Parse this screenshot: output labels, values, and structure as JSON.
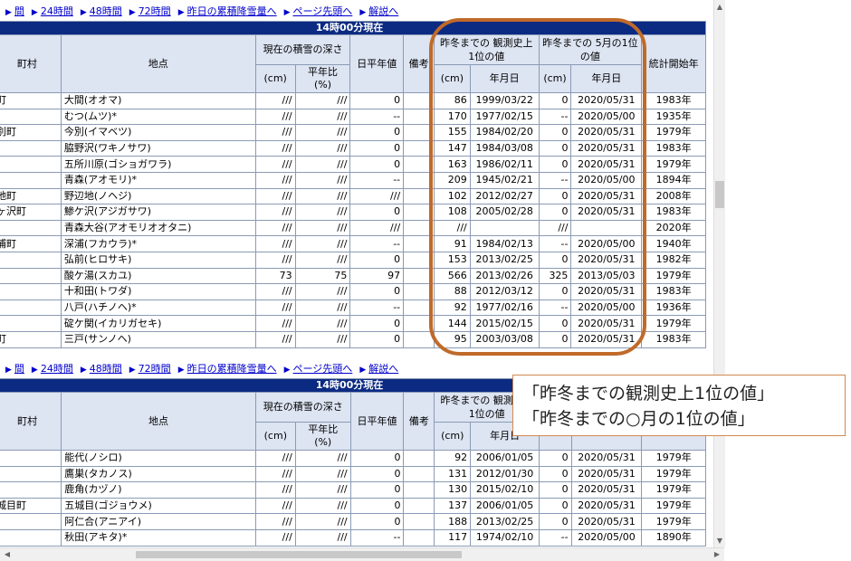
{
  "nav_links": [
    {
      "sep": "▶",
      "label": "間"
    },
    {
      "sep": "▶",
      "label": "24時間"
    },
    {
      "sep": "▶",
      "label": "48時間"
    },
    {
      "sep": "▶",
      "label": "72時間"
    },
    {
      "sep": "▶",
      "label": "昨日の累積降雪量へ"
    },
    {
      "sep": "▶",
      "label": "ページ先頭へ"
    },
    {
      "sep": "▶",
      "label": "解説へ"
    }
  ],
  "table_top": {
    "banner": "14時00分現在",
    "headers": {
      "town": "町村",
      "point": "地点",
      "current_depth": "現在の積雪の深さ",
      "cm": "(cm)",
      "ratio": "平年比 (%)",
      "daily_normal": "日平年値",
      "remarks": "備考",
      "record_group": "昨冬までの 観測史上1位の値",
      "month_group": "昨冬までの 5月の1位の値",
      "date": "年月日",
      "start_year": "統計開始年"
    },
    "rows": [
      {
        "town": "町",
        "point": "大間(オオマ)",
        "depth": "///",
        "ratio": "///",
        "normal": "0",
        "remark": "",
        "rec": "86",
        "rec_date": "1999/03/22",
        "mon": "0",
        "mon_date": "2020/05/31",
        "start": "1983年"
      },
      {
        "town": "",
        "point": "むつ(ムツ)*",
        "depth": "///",
        "ratio": "///",
        "normal": "--",
        "remark": "",
        "rec": "170",
        "rec_date": "1977/02/15",
        "mon": "--",
        "mon_date": "2020/05/00",
        "start": "1935年"
      },
      {
        "town": "別町",
        "point": "今別(イマベツ)",
        "depth": "///",
        "ratio": "///",
        "normal": "0",
        "remark": "",
        "rec": "155",
        "rec_date": "1984/02/20",
        "mon": "0",
        "mon_date": "2020/05/31",
        "start": "1979年"
      },
      {
        "town": "",
        "point": "脇野沢(ワキノサワ)",
        "depth": "///",
        "ratio": "///",
        "normal": "0",
        "remark": "",
        "rec": "147",
        "rec_date": "1984/03/08",
        "mon": "0",
        "mon_date": "2020/05/31",
        "start": "1983年"
      },
      {
        "town": "",
        "point": "五所川原(ゴショガワラ)",
        "depth": "///",
        "ratio": "///",
        "normal": "0",
        "remark": "",
        "rec": "163",
        "rec_date": "1986/02/11",
        "mon": "0",
        "mon_date": "2020/05/31",
        "start": "1979年"
      },
      {
        "town": "",
        "point": "青森(アオモリ)*",
        "depth": "///",
        "ratio": "///",
        "normal": "--",
        "remark": "",
        "rec": "209",
        "rec_date": "1945/02/21",
        "mon": "--",
        "mon_date": "2020/05/00",
        "start": "1894年"
      },
      {
        "town": "地町",
        "point": "野辺地(ノヘジ)",
        "depth": "///",
        "ratio": "///",
        "normal": "///",
        "remark": "",
        "rec": "102",
        "rec_date": "2012/02/27",
        "mon": "0",
        "mon_date": "2020/05/31",
        "start": "2008年"
      },
      {
        "town": "ヶ沢町",
        "point": "鯵ケ沢(アジガサワ)",
        "depth": "///",
        "ratio": "///",
        "normal": "0",
        "remark": "",
        "rec": "108",
        "rec_date": "2005/02/28",
        "mon": "0",
        "mon_date": "2020/05/31",
        "start": "1983年"
      },
      {
        "town": "",
        "point": "青森大谷(アオモリオオタニ)",
        "depth": "///",
        "ratio": "///",
        "normal": "///",
        "remark": "",
        "rec": "///",
        "rec_date": "",
        "mon": "///",
        "mon_date": "",
        "start": "2020年"
      },
      {
        "town": "浦町",
        "point": "深浦(フカウラ)*",
        "depth": "///",
        "ratio": "///",
        "normal": "--",
        "remark": "",
        "rec": "91",
        "rec_date": "1984/02/13",
        "mon": "--",
        "mon_date": "2020/05/00",
        "start": "1940年"
      },
      {
        "town": "",
        "point": "弘前(ヒロサキ)",
        "depth": "///",
        "ratio": "///",
        "normal": "0",
        "remark": "",
        "rec": "153",
        "rec_date": "2013/02/25",
        "mon": "0",
        "mon_date": "2020/05/31",
        "start": "1982年"
      },
      {
        "town": "",
        "point": "酸ケ湯(スカユ)",
        "depth": "73",
        "ratio": "75",
        "normal": "97",
        "remark": "",
        "rec": "566",
        "rec_date": "2013/02/26",
        "mon": "325",
        "mon_date": "2013/05/03",
        "start": "1979年"
      },
      {
        "town": "",
        "point": "十和田(トワダ)",
        "depth": "///",
        "ratio": "///",
        "normal": "0",
        "remark": "",
        "rec": "88",
        "rec_date": "2012/03/12",
        "mon": "0",
        "mon_date": "2020/05/31",
        "start": "1983年"
      },
      {
        "town": "",
        "point": "八戸(ハチノヘ)*",
        "depth": "///",
        "ratio": "///",
        "normal": "--",
        "remark": "",
        "rec": "92",
        "rec_date": "1977/02/16",
        "mon": "--",
        "mon_date": "2020/05/00",
        "start": "1936年"
      },
      {
        "town": "",
        "point": "碇ケ関(イカリガセキ)",
        "depth": "///",
        "ratio": "///",
        "normal": "0",
        "remark": "",
        "rec": "144",
        "rec_date": "2015/02/15",
        "mon": "0",
        "mon_date": "2020/05/31",
        "start": "1979年"
      },
      {
        "town": "町",
        "point": "三戸(サンノヘ)",
        "depth": "///",
        "ratio": "///",
        "normal": "0",
        "remark": "",
        "rec": "95",
        "rec_date": "2003/03/08",
        "mon": "0",
        "mon_date": "2020/05/31",
        "start": "1983年"
      }
    ]
  },
  "table_bottom": {
    "banner": "14時00分現在",
    "headers": {
      "town": "町村",
      "point": "地点",
      "current_depth": "現在の積雪の深さ",
      "cm": "(cm)",
      "ratio": "平年比 (%)",
      "daily_normal": "日平年値",
      "remarks": "備考",
      "record_group": "昨冬までの 観測史上1位の値",
      "date": "年月日"
    },
    "rows": [
      {
        "town": "",
        "point": "能代(ノシロ)",
        "depth": "///",
        "ratio": "///",
        "normal": "0",
        "remark": "",
        "rec": "92",
        "rec_date": "2006/01/05",
        "mon": "0",
        "mon_date": "2020/05/31",
        "start": "1979年"
      },
      {
        "town": "",
        "point": "鷹巣(タカノス)",
        "depth": "///",
        "ratio": "///",
        "normal": "0",
        "remark": "",
        "rec": "131",
        "rec_date": "2012/01/30",
        "mon": "0",
        "mon_date": "2020/05/31",
        "start": "1979年"
      },
      {
        "town": "",
        "point": "鹿角(カヅノ)",
        "depth": "///",
        "ratio": "///",
        "normal": "0",
        "remark": "",
        "rec": "130",
        "rec_date": "2015/02/10",
        "mon": "0",
        "mon_date": "2020/05/31",
        "start": "1979年"
      },
      {
        "town": "城目町",
        "point": "五城目(ゴジョウメ)",
        "depth": "///",
        "ratio": "///",
        "normal": "0",
        "remark": "",
        "rec": "137",
        "rec_date": "2006/01/05",
        "mon": "0",
        "mon_date": "2020/05/31",
        "start": "1979年"
      },
      {
        "town": "",
        "point": "阿仁合(アニアイ)",
        "depth": "///",
        "ratio": "///",
        "normal": "0",
        "remark": "",
        "rec": "188",
        "rec_date": "2013/02/25",
        "mon": "0",
        "mon_date": "2020/05/31",
        "start": "1979年"
      },
      {
        "town": "",
        "point": "秋田(アキタ)*",
        "depth": "///",
        "ratio": "///",
        "normal": "--",
        "remark": "",
        "rec": "117",
        "rec_date": "1974/02/10",
        "mon": "--",
        "mon_date": "2020/05/00",
        "start": "1890年"
      }
    ]
  },
  "callout": {
    "line1": "「昨冬までの観測史上1位の値」",
    "line2": "「昨冬までの○月の1位の値」"
  },
  "colors": {
    "banner": "#0b2a82",
    "header_bg": "#dde4f2",
    "ring": "#c06a2a",
    "link": "#0000cc"
  }
}
